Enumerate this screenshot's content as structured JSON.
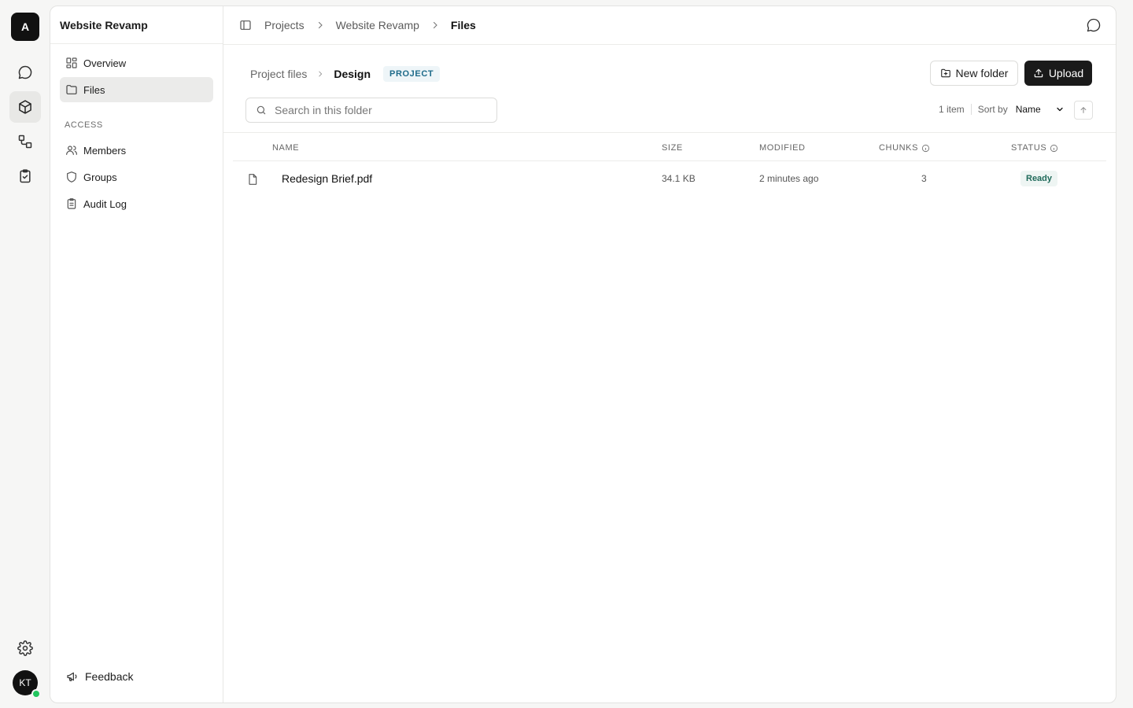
{
  "rail": {
    "logo_letter": "A",
    "items": [
      {
        "icon": "chat-icon"
      },
      {
        "icon": "cube-icon",
        "active": true
      },
      {
        "icon": "workflow-icon"
      },
      {
        "icon": "clipboard-check-icon"
      }
    ],
    "settings_icon": "gear-icon",
    "avatar_initials": "KT"
  },
  "sidebar": {
    "project_title": "Website Revamp",
    "items": [
      {
        "label": "Overview",
        "icon": "grid-icon"
      },
      {
        "label": "Files",
        "icon": "folder-icon",
        "active": true
      }
    ],
    "access_label": "ACCESS",
    "access_items": [
      {
        "label": "Members",
        "icon": "users-icon"
      },
      {
        "label": "Groups",
        "icon": "shield-icon"
      },
      {
        "label": "Audit Log",
        "icon": "clipboard-icon"
      }
    ],
    "feedback_label": "Feedback"
  },
  "topbar": {
    "breadcrumbs": [
      "Projects",
      "Website Revamp",
      "Files"
    ]
  },
  "folder": {
    "crumbs": [
      "Project files",
      "Design"
    ],
    "badge": "PROJECT",
    "new_folder_label": "New folder",
    "upload_label": "Upload",
    "search_placeholder": "Search in this folder",
    "item_count": "1 item",
    "sort_by_label": "Sort by",
    "sort_value": "Name"
  },
  "table": {
    "headers": {
      "name": "NAME",
      "size": "SIZE",
      "modified": "MODIFIED",
      "chunks": "CHUNKS",
      "status": "STATUS"
    },
    "rows": [
      {
        "name": "Redesign Brief.pdf",
        "size": "34.1 KB",
        "modified": "2 minutes ago",
        "chunks": "3",
        "status": "Ready"
      }
    ]
  },
  "colors": {
    "accent": "#1a1a1a",
    "badge_project": "#1f6b8a",
    "status_ready": "#1f6a5a",
    "presence": "#22c55e"
  }
}
